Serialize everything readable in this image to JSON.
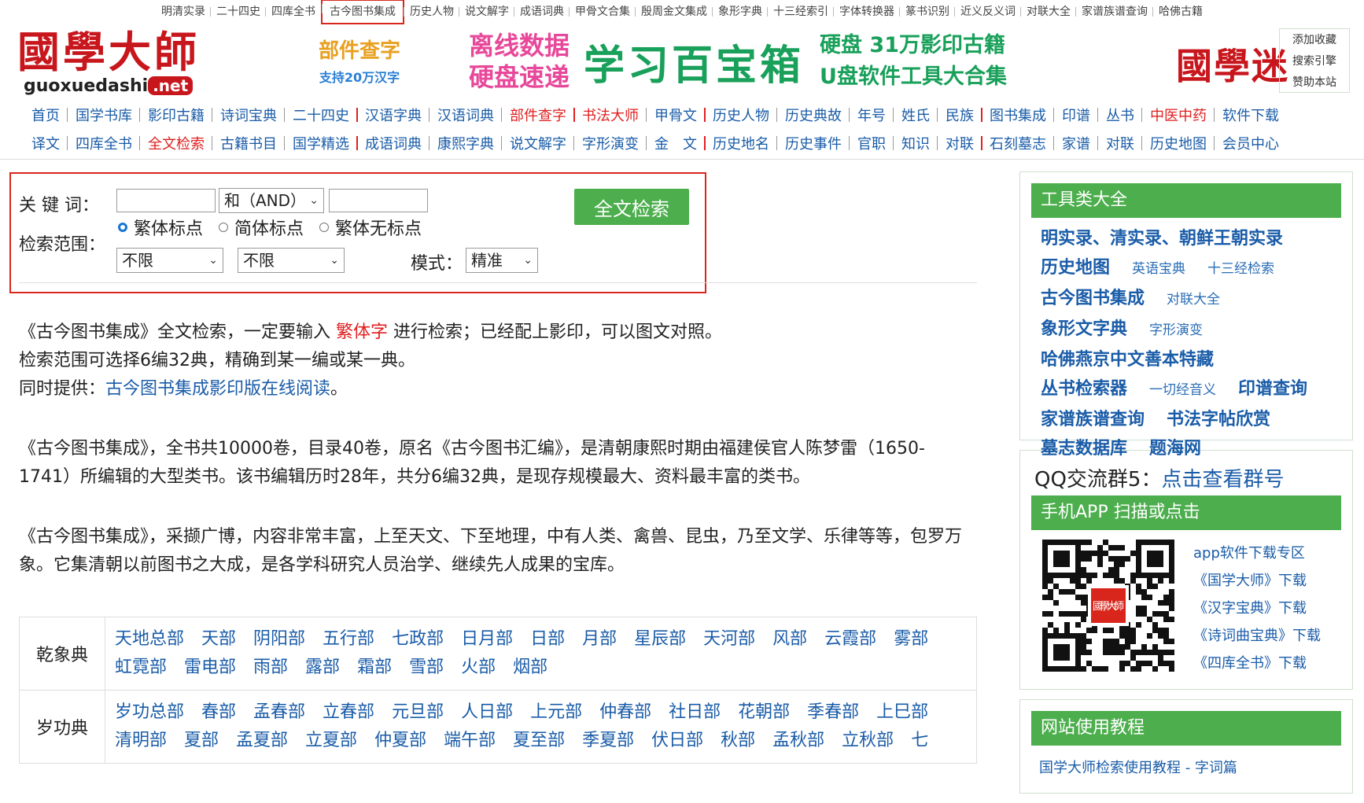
{
  "topbar": {
    "items": [
      "明清实录",
      "二十四史",
      "四库全书",
      "古今图书集成",
      "历史人物",
      "说文解字",
      "成语词典",
      "甲骨文合集",
      "殷周金文集成",
      "象形字典",
      "十三经索引",
      "字体转换器",
      "篆书识别",
      "近义反义词",
      "对联大全",
      "家谱族谱查询",
      "哈佛古籍"
    ],
    "highlighted_index": 3
  },
  "header": {
    "logo_cn": "國學大師",
    "logo_en": "guoxuedashi",
    "logo_net": ".net",
    "bujian_title": "部件查字",
    "bujian_sub": "支持20万汉字",
    "banner_left_1": "离线数据",
    "banner_left_2": "硬盘速递",
    "banner_main": "学习百宝箱",
    "banner_right_1": "硬盘 31万影印古籍",
    "banner_right_2": "U盘软件工具大合集",
    "logo2": "國學迷",
    "side_links": [
      "添加收藏",
      "搜索引擎",
      "赞助本站"
    ]
  },
  "nav": {
    "row1": [
      {
        "label": "首页"
      },
      {
        "label": "国学书库"
      },
      {
        "label": "影印古籍"
      },
      {
        "label": "诗词宝典"
      },
      {
        "label": "二十四史"
      },
      {
        "label": "汉语字典",
        "red_sep": true
      },
      {
        "label": "汉语词典"
      },
      {
        "label": "部件查字",
        "red": true
      },
      {
        "label": "书法大师",
        "red": true,
        "red_sep": true
      },
      {
        "label": "甲骨文"
      },
      {
        "label": "历史人物",
        "red_sep": true
      },
      {
        "label": "历史典故"
      },
      {
        "label": "年号"
      },
      {
        "label": "姓氏"
      },
      {
        "label": "民族"
      },
      {
        "label": "图书集成",
        "red_sep": true
      },
      {
        "label": "印谱"
      },
      {
        "label": "丛书"
      },
      {
        "label": "中医中药",
        "red": true
      },
      {
        "label": "软件下载"
      }
    ],
    "row2": [
      {
        "label": "译文"
      },
      {
        "label": "四库全书"
      },
      {
        "label": "全文检索",
        "red": true
      },
      {
        "label": "古籍书目"
      },
      {
        "label": "国学精选"
      },
      {
        "label": "成语词典",
        "red_sep": true
      },
      {
        "label": "康熙字典"
      },
      {
        "label": "说文解字"
      },
      {
        "label": "字形演变"
      },
      {
        "label": "金　文"
      },
      {
        "label": "历史地名",
        "red_sep": true
      },
      {
        "label": "历史事件"
      },
      {
        "label": "官职"
      },
      {
        "label": "知识"
      },
      {
        "label": "对联"
      },
      {
        "label": "石刻墓志",
        "red_sep": true
      },
      {
        "label": "家谱"
      },
      {
        "label": "对联"
      },
      {
        "label": "历史地图"
      },
      {
        "label": "会员中心"
      }
    ]
  },
  "search": {
    "keyword_label": "关 键 词：",
    "keyword1_value": "",
    "operator_value": "和（AND）",
    "keyword2_value": "",
    "submit_label": "全文检索",
    "range_label": "检索范围：",
    "radio_options": [
      "繁体标点",
      "简体标点",
      "繁体无标点"
    ],
    "radio_selected": 0,
    "range1_value": "不限",
    "range2_value": "不限",
    "mode_label": "模式：",
    "mode_value": "精准"
  },
  "main": {
    "p1_a": "《古今图书集成》全文检索，一定要输入 ",
    "p1_red": "繁体字",
    "p1_b": " 进行检索；已经配上影印，可以图文对照。",
    "p2": "检索范围可选择6编32典，精确到某一编或某一典。",
    "p3_a": "同时提供：",
    "p3_link": "古今图书集成影印版在线阅读",
    "p3_b": "。",
    "p4": "《古今图书集成》，全书共10000卷，目录40卷，原名《古今图书汇编》，是清朝康熙时期由福建侯官人陈梦雷（1650-1741）所编辑的大型类书。该书编辑历时28年，共分6编32典，是现存规模最大、资料最丰富的类书。",
    "p5": "《古今图书集成》，采撷广博，内容非常丰富，上至天文、下至地理，中有人类、禽兽、昆虫，乃至文学、乐律等等，包罗万象。它集清朝以前图书之大成，是各学科研究人员治学、继续先人成果的宝库。"
  },
  "categories": [
    {
      "name": "乾象典",
      "items": [
        "天地总部",
        "天部",
        "阴阳部",
        "五行部",
        "七政部",
        "日月部",
        "日部",
        "月部",
        "星辰部",
        "天河部",
        "风部",
        "云霞部",
        "雾部",
        "虹霓部",
        "雷电部",
        "雨部",
        "露部",
        "霜部",
        "雪部",
        "火部",
        "烟部"
      ]
    },
    {
      "name": "岁功典",
      "items": [
        "岁功总部",
        "春部",
        "孟春部",
        "立春部",
        "元旦部",
        "人日部",
        "上元部",
        "仲春部",
        "社日部",
        "花朝部",
        "季春部",
        "上巳部",
        "清明部",
        "夏部",
        "孟夏部",
        "立夏部",
        "仲夏部",
        "端午部",
        "夏至部",
        "季夏部",
        "伏日部",
        "秋部",
        "孟秋部",
        "立秋部",
        "七"
      ]
    }
  ],
  "sidebar": {
    "tools_title": "工具类大全",
    "tools": [
      {
        "label": "明实录、清实录、朝鲜王朝实录",
        "size": "big"
      },
      {
        "label": "历史地图",
        "size": "big"
      },
      {
        "label": "英语宝典",
        "size": "small"
      },
      {
        "label": "十三经检索",
        "size": "small"
      },
      {
        "label": "古今图书集成",
        "size": "big"
      },
      {
        "label": "对联大全",
        "size": "small"
      },
      {
        "label": "象形文字典",
        "size": "big"
      },
      {
        "label": "字形演变",
        "size": "small"
      },
      {
        "label": "哈佛燕京中文善本特藏",
        "size": "big"
      },
      {
        "label": "丛书检索器",
        "size": "big"
      },
      {
        "label": "一切经音义",
        "size": "small"
      },
      {
        "label": "印谱查询",
        "size": "big"
      },
      {
        "label": "家谱族谱查询",
        "size": "big"
      },
      {
        "label": "书法字帖欣赏",
        "size": "big"
      },
      {
        "label": "墓志数据库",
        "size": "big"
      },
      {
        "label": "题海网",
        "size": "big"
      }
    ],
    "qq_prefix": "QQ交流群5：",
    "qq_link": "点击查看群号",
    "app_title": "手机APP 扫描或点击",
    "qr_center_text": "國學大師",
    "app_links": [
      "app软件下载专区",
      "《国学大师》下载",
      "《汉字宝典》下载",
      "《诗词曲宝典》下载",
      "《四库全书》下载"
    ],
    "tutorial_title": "网站使用教程",
    "tutorial_item": "国学大师检索使用教程 - 字词篇"
  }
}
